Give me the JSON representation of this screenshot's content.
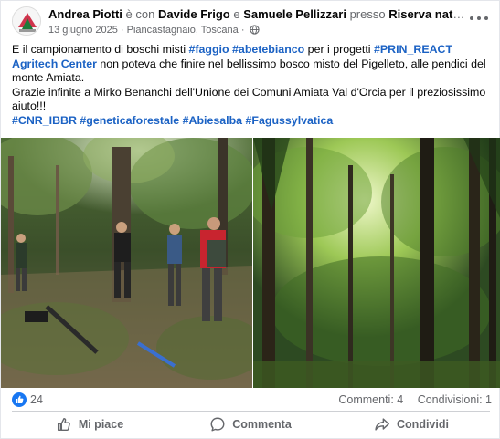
{
  "post": {
    "author": "Andrea Piotti",
    "with_word": "è con",
    "tagged1": "Davide Frigo",
    "and_word": "e",
    "tagged2": "Samuele Pellizzari",
    "at_word": "presso",
    "place": "Riserva naturale Pigell...",
    "date": "13 giugno 2025",
    "sep": "·",
    "location": "Piancastagnaio, Toscana",
    "sep2": "·",
    "text": {
      "p1_a": "E il campionamento di boschi misti ",
      "p1_tag1": "#faggio",
      "p1_tag2": "#abetebianco",
      "p1_b": " per i progetti ",
      "p1_tag3": "#PRIN_REACT Agritech Center",
      "p1_c": " non poteva che finire nel bellissimo bosco misto del Pigelleto, alle pendici del monte Amiata.",
      "p2": "Grazie infinite a Mirko Benanchi dell'Unione dei Comuni Amiata Val d'Orcia per il preziosissimo aiuto!!!",
      "tags": [
        "#CNR_IBBR",
        "#geneticaforestale",
        "#Abiesalba",
        "#Fagussylvatica"
      ]
    }
  },
  "stats": {
    "likes": "24",
    "comments": "Commenti: 4",
    "shares": "Condivisioni: 1"
  },
  "actions": {
    "like": "Mi piace",
    "comment": "Commenta",
    "share": "Condividi"
  },
  "colors": {
    "hashtag": "#1b62c4",
    "like_blue": "#1877f2",
    "muted": "#65676b",
    "forest_dark": "#23331c",
    "forest_light": "#8cc14a"
  },
  "icons": {
    "more": "more-horizontal-icon",
    "globe": "globe-icon",
    "like_badge": "like-reaction-icon",
    "like": "thumbs-up-icon",
    "comment": "comment-bubble-icon",
    "share": "share-arrow-icon"
  }
}
